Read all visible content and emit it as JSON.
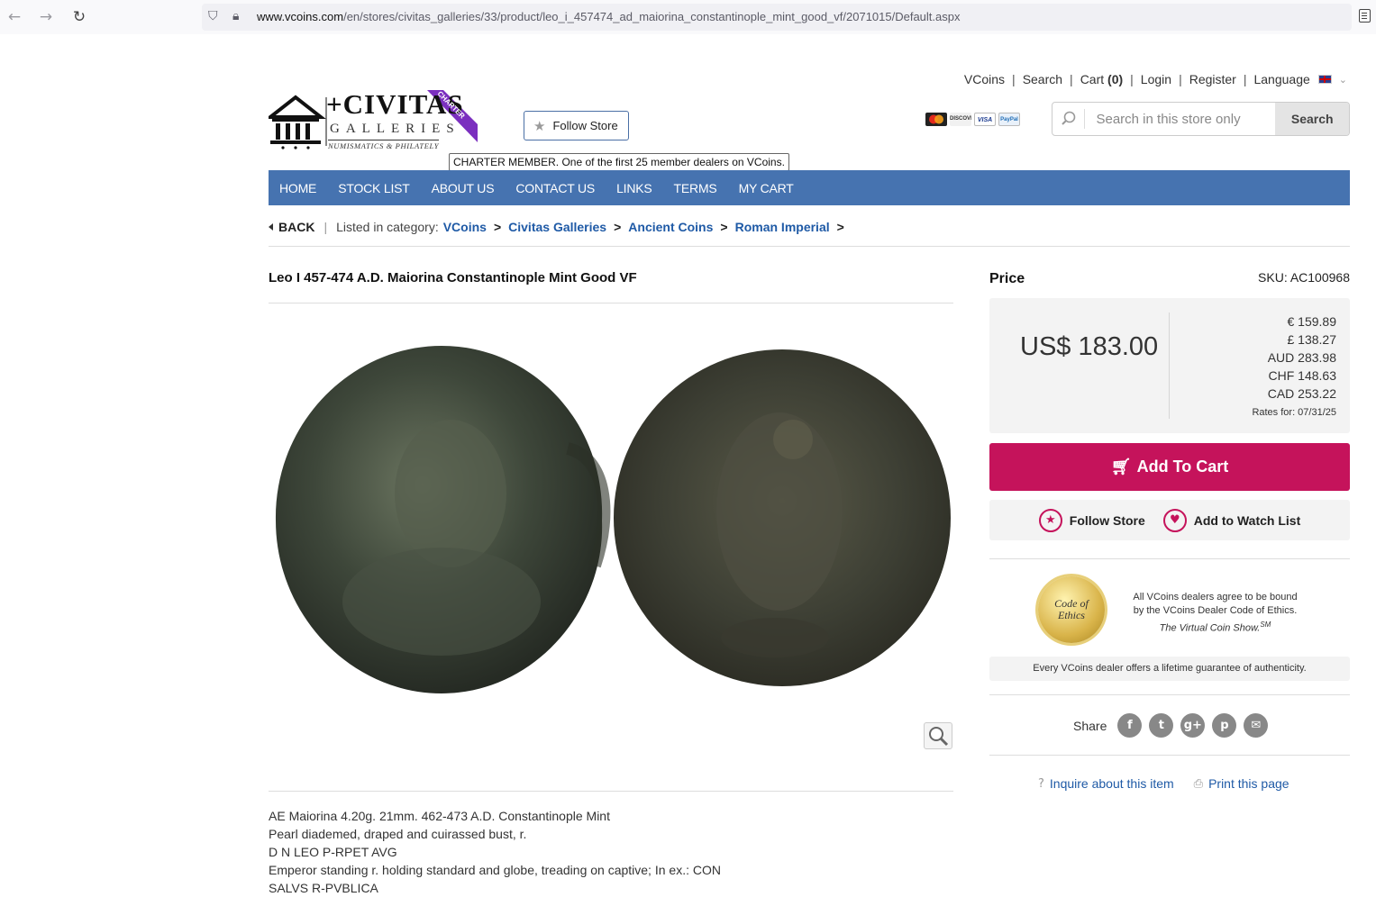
{
  "browser": {
    "url_domain": "www.vcoins.com",
    "url_path": "/en/stores/civitas_galleries/33/product/leo_i_457474_ad_maiorina_constantinople_mint_good_vf/2071015/Default.aspx"
  },
  "toplinks": {
    "vcoins": "VCoins",
    "search": "Search",
    "cart": "Cart",
    "cart_count": "(0)",
    "login": "Login",
    "register": "Register",
    "language": "Language"
  },
  "logo": {
    "name": "CIVITAS",
    "sub": "GALLERIES",
    "tagline": "NUMISMATICS & PHILATELY",
    "ribbon": "CHARTER"
  },
  "follow_store_header": "Follow Store",
  "tooltip": "CHARTER MEMBER. One of the first 25 member dealers on VCoins.",
  "payment_cards": [
    {
      "name": "mastercard",
      "color": "#e35c1b"
    },
    {
      "name": "DISCOVER",
      "color": "#d9d9d9"
    },
    {
      "name": "VISA",
      "color": "#1a3a8f"
    },
    {
      "name": "PayPal",
      "color": "#1c6bb5"
    }
  ],
  "search": {
    "placeholder": "Search in this store only",
    "button": "Search"
  },
  "nav": [
    "HOME",
    "STOCK LIST",
    "ABOUT US",
    "CONTACT US",
    "LINKS",
    "TERMS",
    "MY CART"
  ],
  "breadcrumb": {
    "back": "BACK",
    "listed_in": "Listed in category:",
    "items": [
      "VCoins",
      "Civitas Galleries",
      "Ancient Coins",
      "Roman Imperial"
    ]
  },
  "product": {
    "title": "Leo I 457-474 A.D. Maiorina Constantinople Mint Good VF",
    "description": [
      "AE Maiorina 4.20g. 21mm. 462-473 A.D. Constantinople Mint",
      "Pearl diademed, draped and cuirassed bust, r.",
      "D N LEO P-RPET AVG",
      "Emperor standing r. holding standard and globe, treading on captive; In ex.: CON",
      "SALVS R-PVBLICA"
    ]
  },
  "price": {
    "label": "Price",
    "sku": "SKU: AC100968",
    "main": "US$ 183.00",
    "conversions": [
      "€ 159.89",
      "£ 138.27",
      "AUD 283.98",
      "CHF 148.63",
      "CAD 253.22"
    ],
    "rates_date": "Rates for: 07/31/25"
  },
  "actions": {
    "add_to_cart": "Add To Cart",
    "follow_store": "Follow Store",
    "watch_list": "Add to Watch List"
  },
  "ethics": {
    "seal_line1": "Code of",
    "seal_line2": "Ethics",
    "line1": "All VCoins dealers agree to be bound",
    "line2": "by the VCoins Dealer Code of Ethics.",
    "vcs": "The Virtual Coin Show.",
    "sm": "SM",
    "guarantee": "Every VCoins dealer offers a lifetime guarantee of authenticity."
  },
  "share": {
    "label": "Share",
    "icons": [
      "f",
      "t",
      "g+",
      "p",
      "✉"
    ]
  },
  "links": {
    "inquire": "Inquire about this item",
    "print": "Print this page"
  },
  "colors": {
    "nav_blue": "#4673b0",
    "link_blue": "#1f5aa6",
    "cart_magenta": "#c5135b",
    "ribbon_purple": "#7b2fbf"
  }
}
